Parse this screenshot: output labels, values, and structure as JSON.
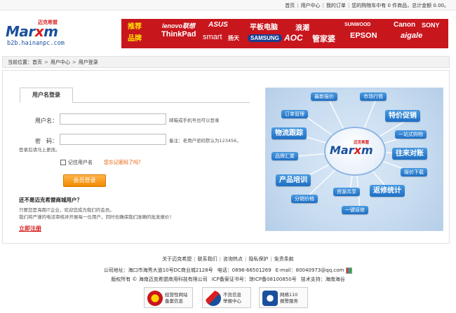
{
  "topbar": {
    "links": [
      "首页",
      "用户中心",
      "我的订单"
    ],
    "cart_text": "您的购物车中有 0 件商品，总计金额 0.00。"
  },
  "header": {
    "logo_word_a": "Mar",
    "logo_word_b": "x",
    "logo_word_c": "m",
    "logo_cn": "迈克希盟",
    "logo_url": "b2b.hainanpc.com",
    "banner_tag_1": "推荐",
    "banner_tag_2": "品牌",
    "brands": [
      "lenovo联想",
      "ThinkPad",
      "ASUS",
      "smart",
      "扬天",
      "平板电脑",
      "SAMSUNG",
      "浪潮",
      "AOC",
      "管家婆",
      "SUNWOOD",
      "EPSON",
      "Canon",
      "SONY",
      "aigale"
    ],
    "accent": "#c8161d"
  },
  "breadcrumb": {
    "prefix": "当前位置：",
    "items": [
      "首页",
      "用户中心",
      "用户登录"
    ],
    "arrow": ">"
  },
  "login": {
    "tab_label": "用户名登录",
    "username_label": "用户名：",
    "username_value": "",
    "username_hint": "邮箱或手机号也可以登录",
    "password_label": "密　码：",
    "password_value": "",
    "password_hint_1": "备注：老用户密码默认为123456，",
    "password_hint_2": "登录后请马上更改。",
    "remember_label": "记住用户名",
    "forgot_label": "您忘记密码了吗？",
    "submit_label": "会员登录",
    "question": "还不是迈克希盟商城用户？",
    "desc_1": "只要您是海南IT企业，欢迎您成为我们的会员。",
    "desc_2": "我们将严谨的电话审核并开展每一位用户，同时也确保我们准确的批发报价！",
    "register_label": "立即注册"
  },
  "diagram": {
    "hub_word_a": "Mar",
    "hub_word_b": "x",
    "hub_word_c": "m",
    "hub_cn": "迈克希盟",
    "nodes": [
      "最新报价",
      "市场行情",
      "订单管理",
      "特价促销",
      "物流跟踪",
      "一站式购物",
      "品牌汇聚",
      "往来对账",
      "报价下载",
      "产品培训",
      "资源共享",
      "返修统计",
      "分销价格",
      "一键返修"
    ]
  },
  "footer": {
    "links": [
      "关于迈克希盟",
      "联系我们",
      "咨询热点",
      "隐私保护",
      "免责条款"
    ],
    "address": "公司地址：海口市海秀大道10号DC商业城2128号",
    "phone": "电话：0898-66501269",
    "email": "E-mail：80040973@qq.com",
    "copyright": "版权所有 © 海南迈克希盟商用科技有限公司",
    "icp": "ICP备案证书号：琼ICP备08100850号",
    "support": "技术支持：海南海谷",
    "badges": [
      {
        "line1": "经营性网站",
        "line2": "备案信息"
      },
      {
        "line1": "不良信息",
        "line2": "举报中心"
      },
      {
        "line1": "网络110",
        "line2": "报警服务"
      }
    ]
  }
}
